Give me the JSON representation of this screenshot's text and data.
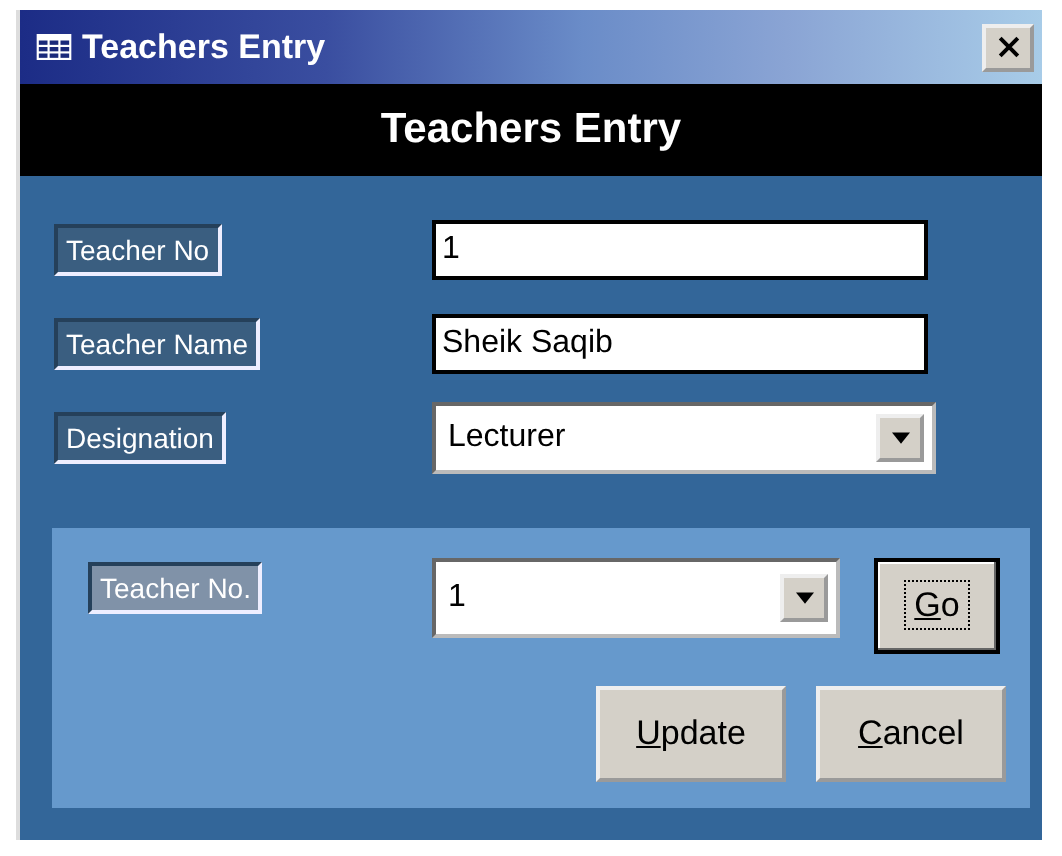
{
  "window": {
    "title": "Teachers Entry"
  },
  "header": {
    "title": "Teachers Entry"
  },
  "fields": [
    {
      "kind": "text",
      "label": "Teacher No",
      "value": "1"
    },
    {
      "kind": "text",
      "label": "Teacher Name",
      "value": "Sheik Saqib"
    },
    {
      "kind": "combo",
      "label": "Designation",
      "value": "Lecturer"
    }
  ],
  "search": {
    "label": "Teacher No.",
    "value": "1",
    "go_button": {
      "key": "G",
      "rest": "o",
      "focused": true
    }
  },
  "buttons": [
    {
      "key": "U",
      "rest": "pdate"
    },
    {
      "key": "C",
      "rest": "ancel"
    }
  ]
}
